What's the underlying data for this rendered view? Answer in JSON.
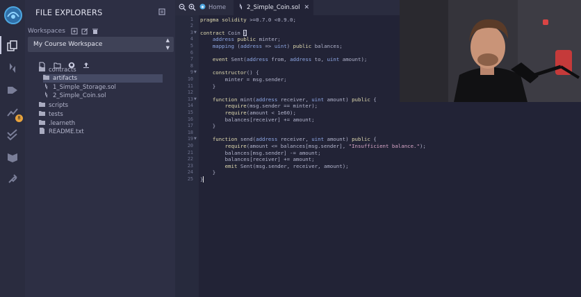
{
  "explorer": {
    "title": "FILE EXPLORERS",
    "workspaces_label": "Workspaces",
    "workspace_selected": "My Course Workspace",
    "tree": [
      {
        "label": "contracts",
        "kind": "folder"
      },
      {
        "label": "artifacts",
        "kind": "folder",
        "selected": true
      },
      {
        "label": "1_Simple_Storage.sol",
        "kind": "sol"
      },
      {
        "label": "2_Simple_Coin.sol",
        "kind": "sol"
      },
      {
        "label": "scripts",
        "kind": "folder"
      },
      {
        "label": "tests",
        "kind": "folder"
      },
      {
        "label": ".learneth",
        "kind": "folder"
      },
      {
        "label": "README.txt",
        "kind": "file"
      }
    ]
  },
  "rail": {
    "badge": "8",
    "icons": [
      "remix-logo-icon",
      "file-explorer-icon",
      "solidity-compiler-icon",
      "deploy-run-icon",
      "analysis-icon",
      "verify-icon",
      "learn-icon",
      "plugin-manager-icon"
    ]
  },
  "editor": {
    "tabs": {
      "home": "Home",
      "file": "2_Simple_Coin.sol"
    },
    "lines": [
      "pragma solidity >=0.7.0 <0.9.0;",
      "",
      "contract Coin {",
      "    address public minter;",
      "    mapping (address => uint) public balances;",
      "",
      "    event Sent(address from, address to, uint amount);",
      "",
      "    constructor() {",
      "        minter = msg.sender;",
      "    }",
      "",
      "    function mint(address receiver, uint amount) public {",
      "        require(msg.sender == minter);",
      "        require(amount < 1e60);",
      "        balances[receiver] += amount;",
      "    }",
      "",
      "    function send(address receiver, uint amount) public {",
      "        require(amount <= balances[msg.sender], \"Insufficient balance.\");",
      "        balances[msg.sender] -= amount;",
      "        balances[receiver] += amount;",
      "        emit Sent(msg.sender, receiver, amount);",
      "    }",
      "}"
    ],
    "foldable_lines": [
      3,
      9,
      13,
      19
    ]
  },
  "colors": {
    "background": "#222336",
    "panel": "#2d2f44",
    "accent": "#4ea7e0",
    "badge": "#e8a33d"
  }
}
